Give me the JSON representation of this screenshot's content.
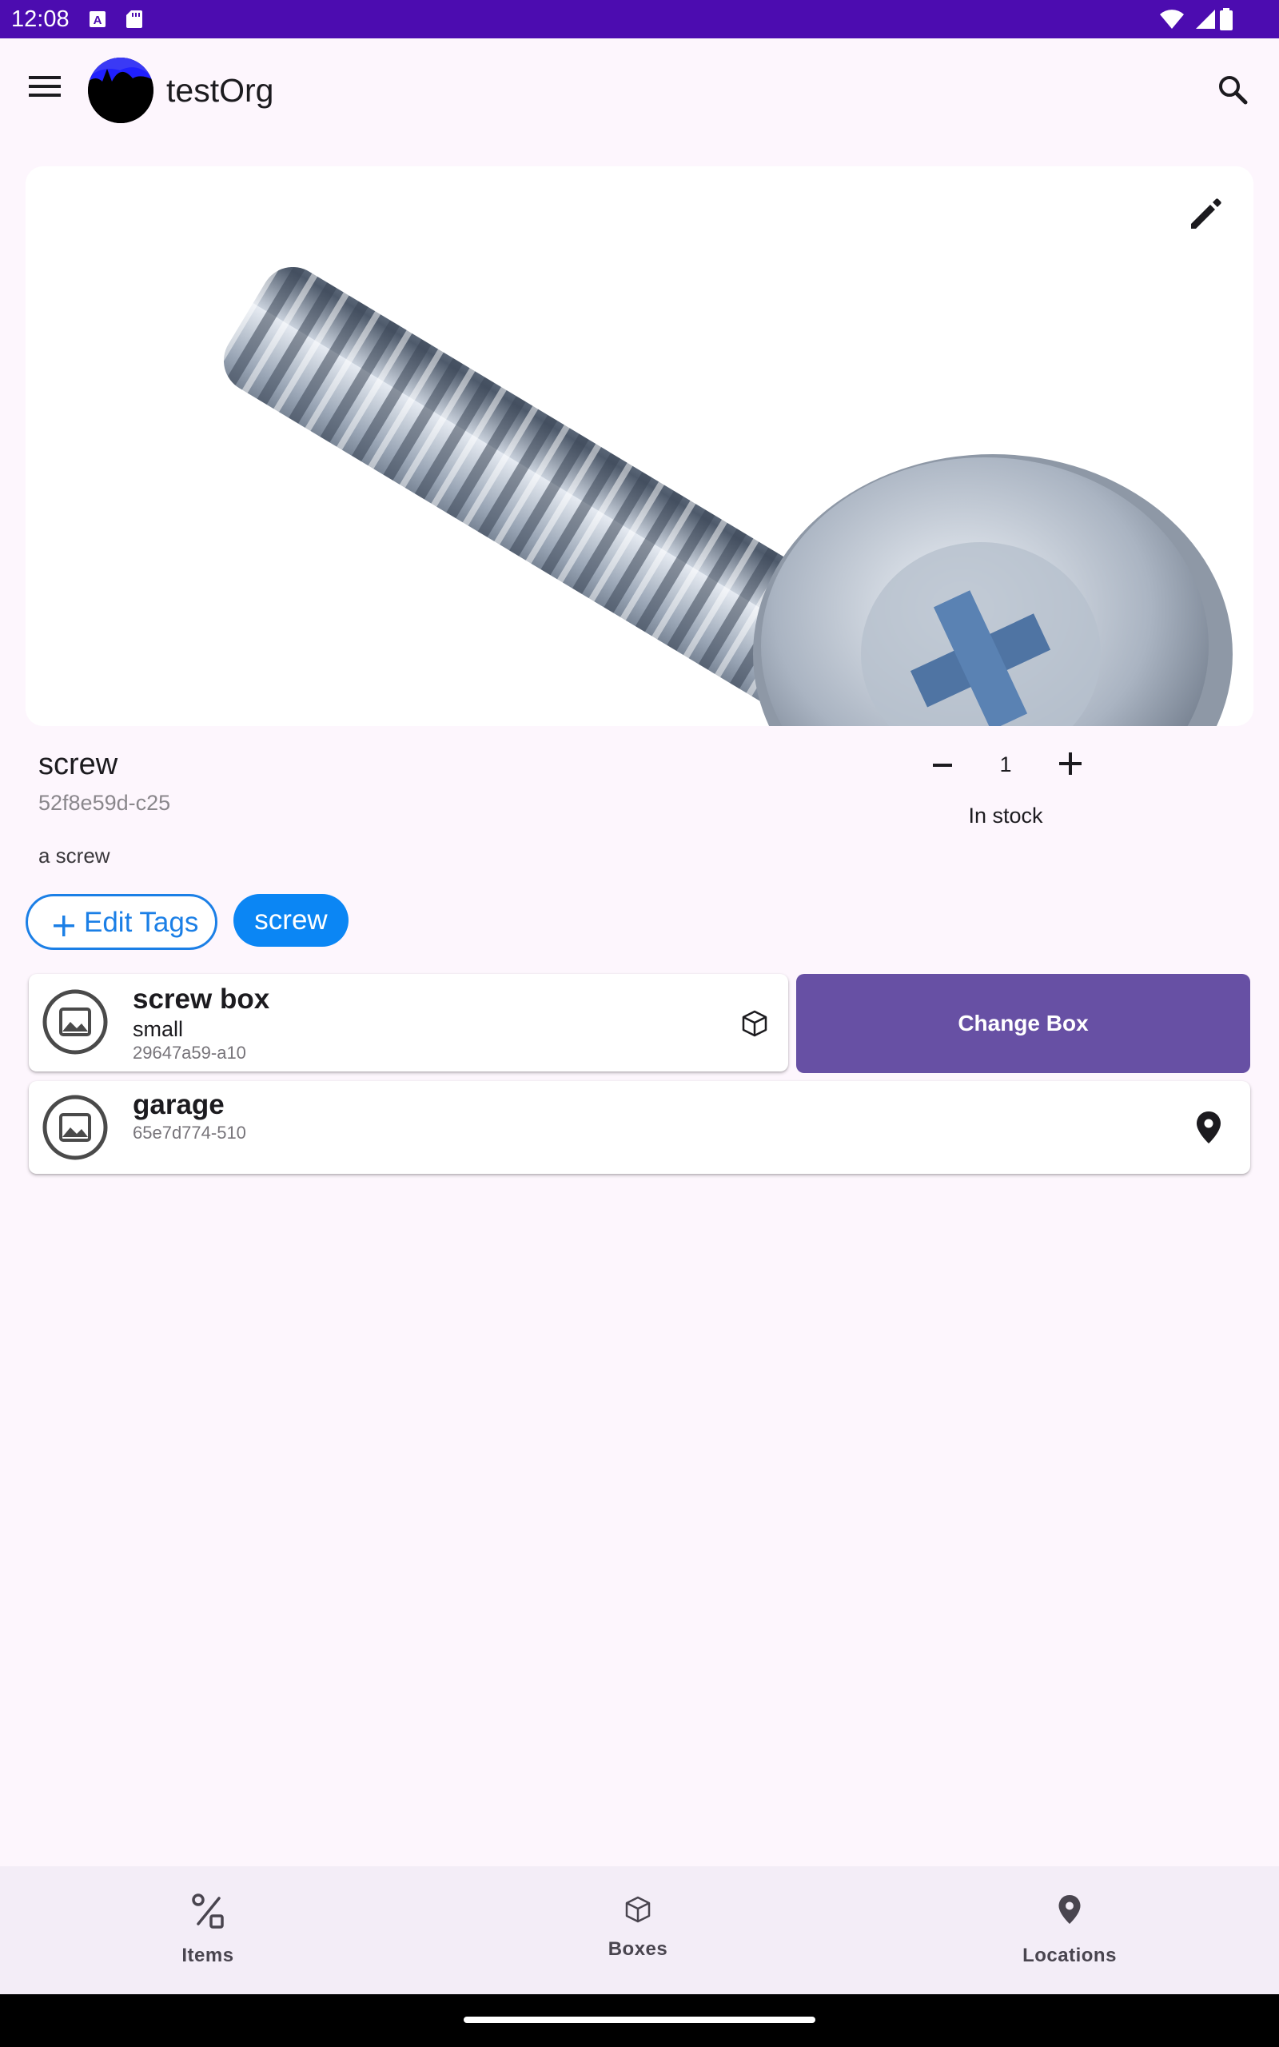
{
  "status_bar": {
    "time": "12:08",
    "icons": [
      "a-icon",
      "sd-card-icon",
      "wifi-icon",
      "signal-icon",
      "battery-icon"
    ]
  },
  "app_bar": {
    "title": "testOrg",
    "menu_icon": "menu-icon",
    "search_icon": "search-icon"
  },
  "item": {
    "name": "screw",
    "id": "52f8e59d-c25",
    "description": "a screw",
    "quantity": "1",
    "stock_status": "In stock"
  },
  "tags": {
    "edit_label": "Edit Tags",
    "items": [
      "screw"
    ]
  },
  "box": {
    "name": "screw box",
    "size": "small",
    "id": "29647a59-a10",
    "change_label": "Change Box"
  },
  "location": {
    "name": "garage",
    "id": "65e7d774-510"
  },
  "bottom_nav": {
    "items": [
      {
        "label": "Items",
        "icon": "items-icon"
      },
      {
        "label": "Boxes",
        "icon": "box-icon"
      },
      {
        "label": "Locations",
        "icon": "location-pin-icon"
      }
    ]
  },
  "colors": {
    "status_bar": "#4c0cb0",
    "background": "#fdf6fd",
    "accent_blue": "#0b86f4",
    "primary_purple": "#6750a4",
    "nav_background": "#f3edf7"
  }
}
